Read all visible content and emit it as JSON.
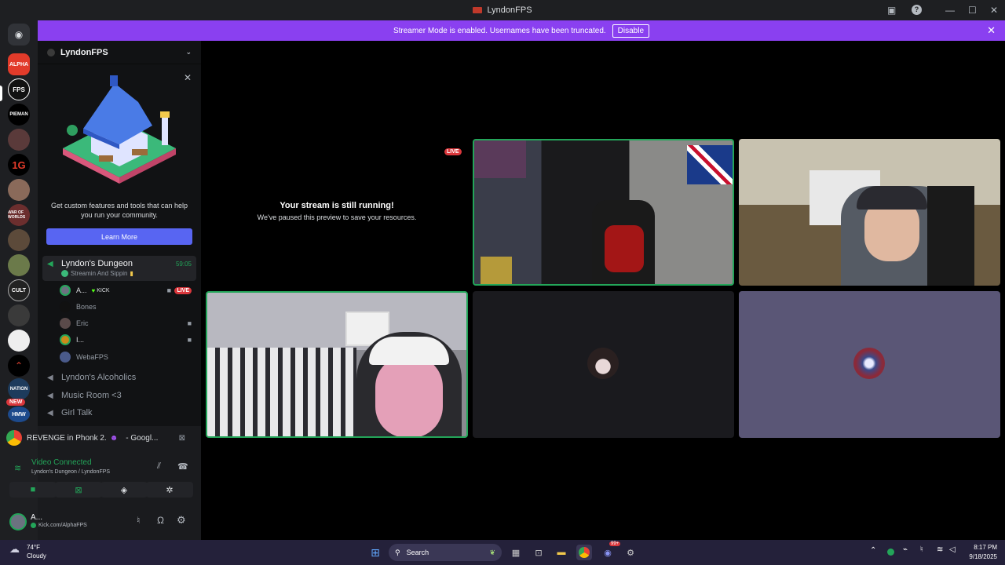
{
  "window": {
    "title": "LyndonFPS"
  },
  "banner": {
    "message": "Streamer Mode is enabled. Usernames have been truncated.",
    "disable_label": "Disable"
  },
  "guild": {
    "name": "LyndonFPS",
    "promo_text": "Get custom features and tools that can help you run your community.",
    "learn_more": "Learn More"
  },
  "channels": {
    "dungeon": {
      "name": "Lyndon's Dungeon",
      "time": "59:05",
      "status": "Streamin And Sippin"
    },
    "users": [
      {
        "name": "A...",
        "badge": "KICK",
        "live": "LIVE"
      },
      {
        "name": "Bones"
      },
      {
        "name": "Eric"
      },
      {
        "name": "I..."
      },
      {
        "name": "WebaFPS"
      }
    ],
    "others": [
      "Lyndon's Alcoholics",
      "Music Room <3",
      "Girl Talk"
    ]
  },
  "server_badge": "NEW",
  "server_labels": [
    "ALPHA",
    "FPS",
    "PIEMAN",
    "1G",
    "WAR OF WORLDS",
    "CULT",
    "NATION",
    "HMW"
  ],
  "now_playing": "REVENGE in Phonk 2.",
  "now_playing_tail": "- Googl...",
  "voice": {
    "status": "Video Connected",
    "channel": "Lyndon's Dungeon / LyndonFPS"
  },
  "user": {
    "name": "A...",
    "status": "Kick.com/AlphaFPS"
  },
  "stream": {
    "live": "LIVE",
    "title": "Your stream is still running!",
    "subtitle": "We've paused this preview to save your resources."
  },
  "taskbar": {
    "temp": "74°F",
    "weather": "Cloudy",
    "search": "Search",
    "time": "8:17 PM",
    "date": "9/18/2025",
    "notif": "99+"
  },
  "colors": {
    "accent": "#5865f2",
    "banner": "#8a40f0",
    "live": "#da373c",
    "connected": "#23a559"
  }
}
